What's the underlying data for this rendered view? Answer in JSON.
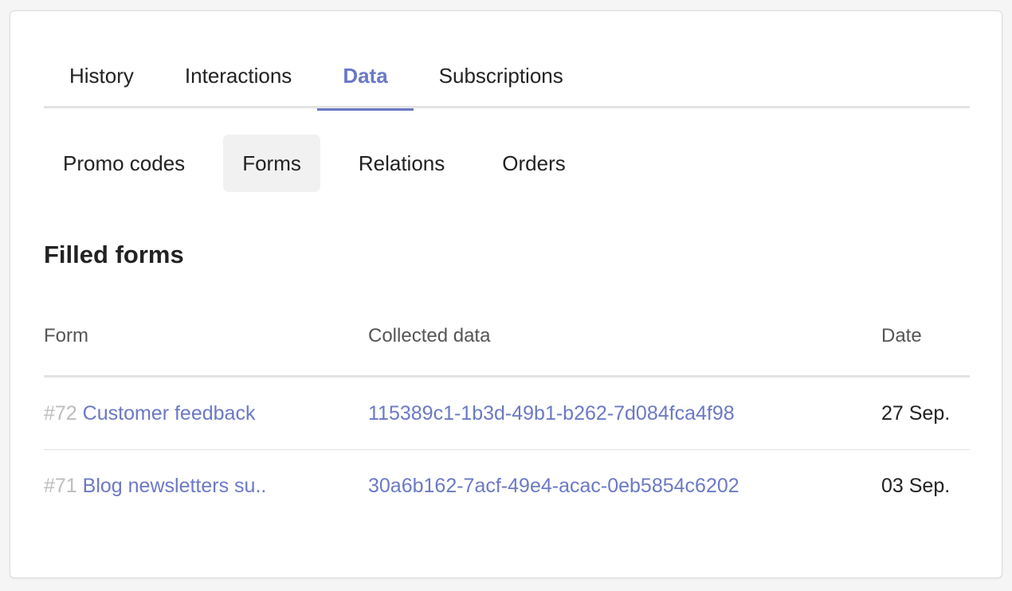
{
  "main_tabs": [
    {
      "label": "History",
      "active": false
    },
    {
      "label": "Interactions",
      "active": false
    },
    {
      "label": "Data",
      "active": true
    },
    {
      "label": "Subscriptions",
      "active": false
    }
  ],
  "sub_tabs": [
    {
      "label": "Promo codes",
      "active": false
    },
    {
      "label": "Forms",
      "active": true
    },
    {
      "label": "Relations",
      "active": false
    },
    {
      "label": "Orders",
      "active": false
    }
  ],
  "section": {
    "title": "Filled forms"
  },
  "table": {
    "headers": {
      "form": "Form",
      "data": "Collected data",
      "date": "Date"
    },
    "rows": [
      {
        "id": "#72",
        "form": "Customer feedback",
        "data": "115389c1-1b3d-49b1-b262-7d084fca4f98",
        "date": "27 Sep."
      },
      {
        "id": "#71",
        "form": "Blog newsletters su..",
        "data": "30a6b162-7acf-49e4-acac-0eb5854c6202",
        "date": "03 Sep."
      }
    ]
  },
  "colors": {
    "accent": "#6b79c6",
    "muted_id": "#bdbdbd",
    "divider": "#e3e3e3",
    "active_subtab_bg": "#f1f1f1"
  }
}
